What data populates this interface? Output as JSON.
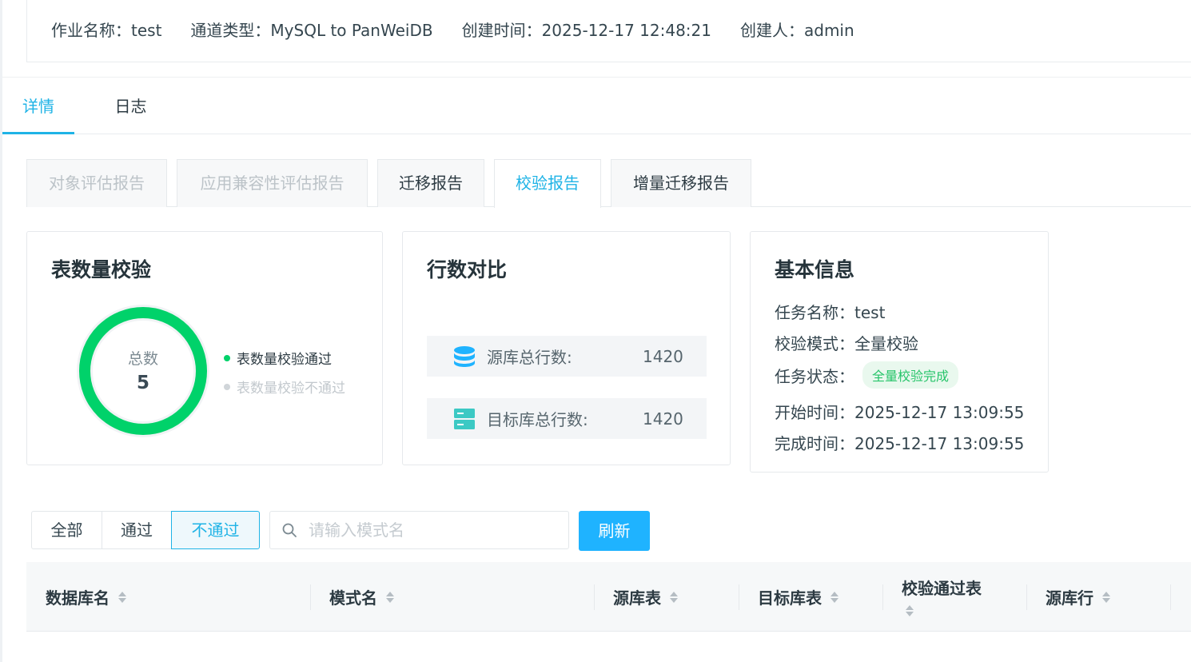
{
  "header": {
    "job_name": "作业名称：test",
    "channel_type": "通道类型：MySQL to PanWeiDB",
    "created_time": "创建时间：2025-12-17 12:48:21",
    "creator": "创建人：admin"
  },
  "main_tabs": [
    "详情",
    "日志"
  ],
  "report_tabs": [
    "对象评估报告",
    "应用兼容性评估报告",
    "迁移报告",
    "校验报告",
    "增量迁移报告"
  ],
  "table_check": {
    "title": "表数量校验",
    "total_label": "总数",
    "total_value": "5",
    "passed_fraction": 1.0,
    "legend_pass": "表数量校验通过",
    "legend_fail": "表数量校验不通过",
    "colors": {
      "pass": "#00d26a",
      "fail": "#d0d5d9"
    }
  },
  "row_compare": {
    "title": "行数对比",
    "source_icon": "database-icon",
    "source_label": "源库总行数:",
    "source_value": "1420",
    "target_icon": "server-icon",
    "target_label": "目标库总行数:",
    "target_value": "1420"
  },
  "basic_info": {
    "title": "基本信息",
    "task_name": "任务名称：test",
    "check_mode": "校验模式：全量校验",
    "task_status_label": "任务状态：",
    "task_status": "全量校验完成",
    "start_time": "开始时间：2025-12-17 13:09:55",
    "finish_time": "完成时间：2025-12-17 13:09:55"
  },
  "filters": {
    "all": "全部",
    "pass": "通过",
    "fail": "不通过",
    "active": "不通过",
    "search_placeholder": "请输入模式名",
    "refresh": "刷新"
  },
  "table": {
    "columns": [
      "数据库名",
      "模式名",
      "源库表",
      "目标库表",
      "校验通过表",
      "源库行"
    ]
  },
  "colors": {
    "accent": "#1fb3e6",
    "button": "#1fb3ff",
    "success": "#00d26a"
  }
}
